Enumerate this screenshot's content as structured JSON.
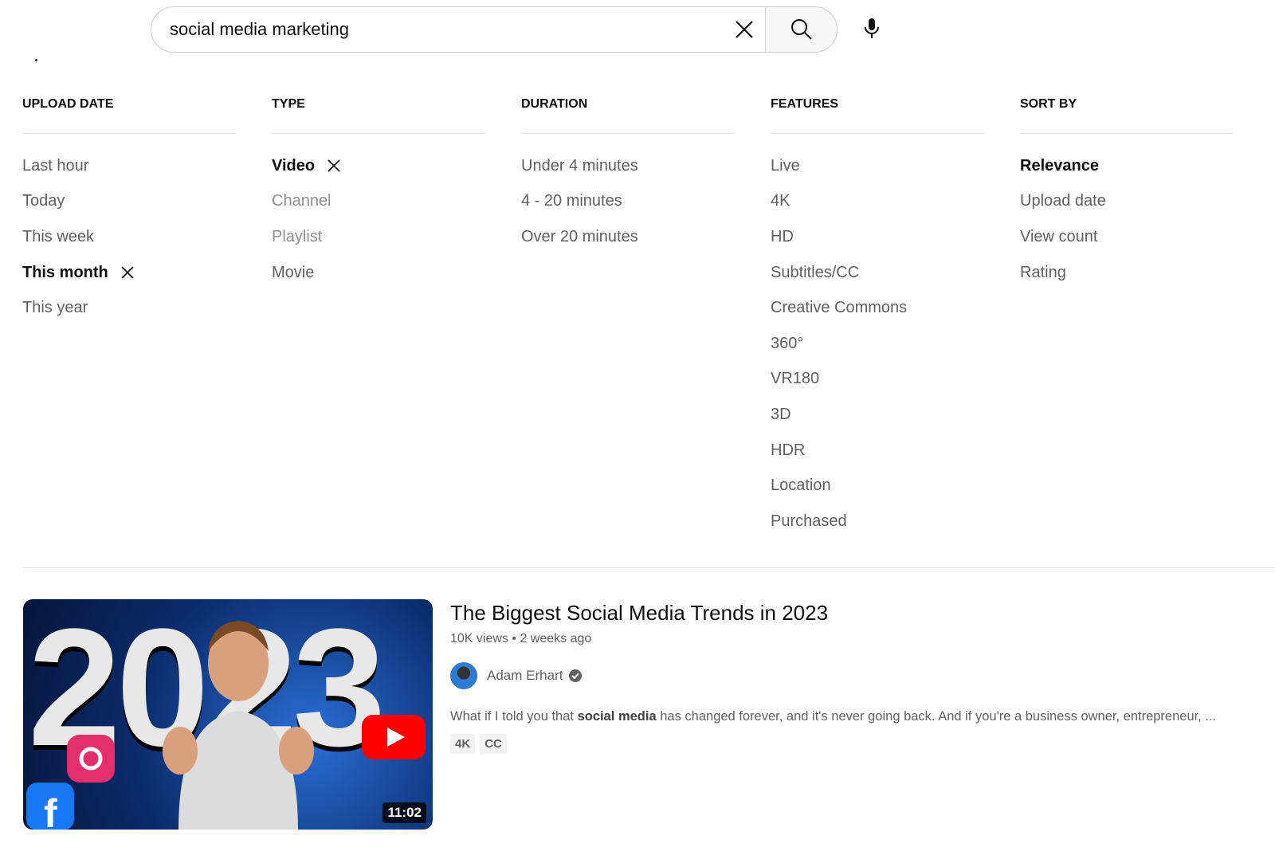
{
  "search": {
    "query": "social media marketing"
  },
  "filters": [
    {
      "header": "UPLOAD DATE",
      "options": [
        {
          "label": "Last hour",
          "state": "normal"
        },
        {
          "label": "Today",
          "state": "normal"
        },
        {
          "label": "This week",
          "state": "normal"
        },
        {
          "label": "This month",
          "state": "selected"
        },
        {
          "label": "This year",
          "state": "normal"
        }
      ]
    },
    {
      "header": "TYPE",
      "options": [
        {
          "label": "Video",
          "state": "selected"
        },
        {
          "label": "Channel",
          "state": "disabled"
        },
        {
          "label": "Playlist",
          "state": "disabled"
        },
        {
          "label": "Movie",
          "state": "normal"
        }
      ]
    },
    {
      "header": "DURATION",
      "options": [
        {
          "label": "Under 4 minutes",
          "state": "normal"
        },
        {
          "label": "4 - 20 minutes",
          "state": "normal"
        },
        {
          "label": "Over 20 minutes",
          "state": "normal"
        }
      ]
    },
    {
      "header": "FEATURES",
      "options": [
        {
          "label": "Live",
          "state": "normal"
        },
        {
          "label": "4K",
          "state": "normal"
        },
        {
          "label": "HD",
          "state": "normal"
        },
        {
          "label": "Subtitles/CC",
          "state": "normal"
        },
        {
          "label": "Creative Commons",
          "state": "normal"
        },
        {
          "label": "360°",
          "state": "normal"
        },
        {
          "label": "VR180",
          "state": "normal"
        },
        {
          "label": "3D",
          "state": "normal"
        },
        {
          "label": "HDR",
          "state": "normal"
        },
        {
          "label": "Location",
          "state": "normal"
        },
        {
          "label": "Purchased",
          "state": "normal"
        }
      ]
    },
    {
      "header": "SORT BY",
      "options": [
        {
          "label": "Relevance",
          "state": "selected-noclear"
        },
        {
          "label": "Upload date",
          "state": "normal"
        },
        {
          "label": "View count",
          "state": "normal"
        },
        {
          "label": "Rating",
          "state": "normal"
        }
      ]
    }
  ],
  "result": {
    "thumbnail_text": "2023",
    "duration": "11:02",
    "title": "The Biggest Social Media Trends in 2023",
    "views": "10K views",
    "age": "2 weeks ago",
    "separator": "•",
    "channel": "Adam Erhart",
    "desc_pre": "What if I told you that ",
    "desc_bold": "social media",
    "desc_post": " has changed forever, and it's never going back. And if you're a business owner, entrepreneur, ...",
    "badges": [
      "4K",
      "CC"
    ]
  }
}
